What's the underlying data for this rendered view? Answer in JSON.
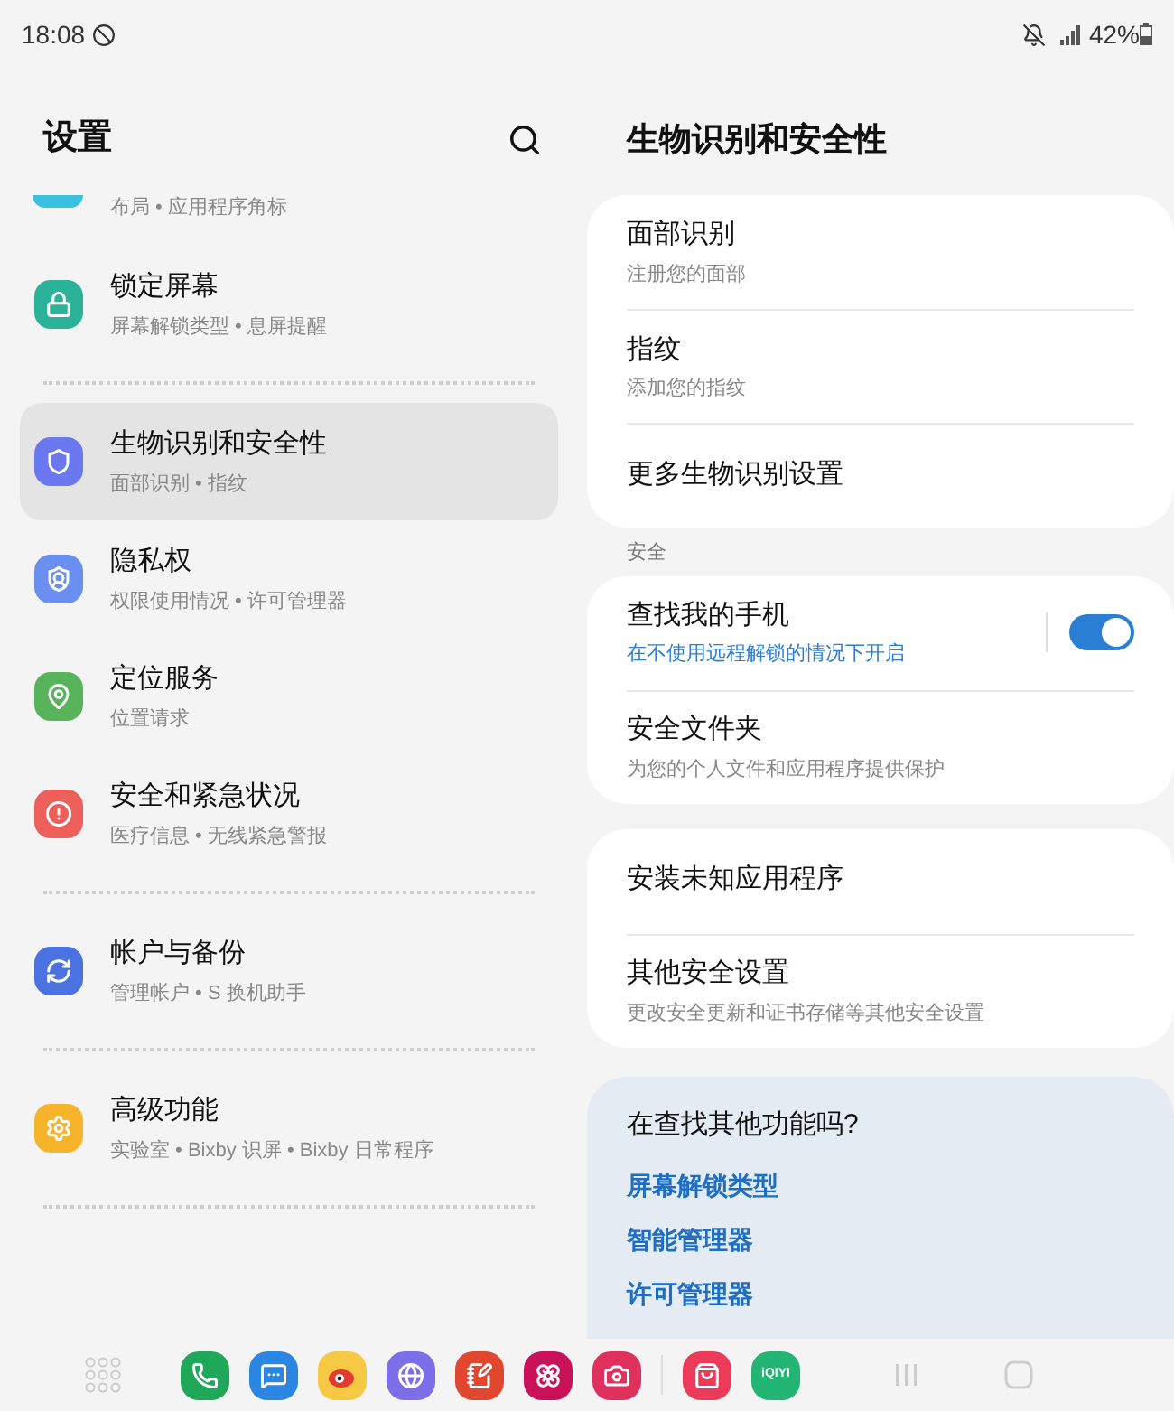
{
  "status_bar": {
    "time": "18:08",
    "battery": "42%"
  },
  "left": {
    "title": "设置",
    "partial_subtitle": "布局 • 应用程序角标",
    "groups": [
      {
        "items": [
          {
            "title": "锁定屏幕",
            "subtitle": "屏幕解锁类型 • 息屏提醒",
            "color": "#2bb39a",
            "selected": false
          }
        ]
      },
      {
        "items": [
          {
            "title": "生物识别和安全性",
            "subtitle": "面部识别 • 指纹",
            "color": "#6c78f0",
            "selected": true
          },
          {
            "title": "隐私权",
            "subtitle": "权限使用情况 • 许可管理器",
            "color": "#6b8ff0",
            "selected": false
          },
          {
            "title": "定位服务",
            "subtitle": "位置请求",
            "color": "#57b45a",
            "selected": false
          },
          {
            "title": "安全和紧急状况",
            "subtitle": "医疗信息 • 无线紧急警报",
            "color": "#ec5f5a",
            "selected": false
          }
        ]
      },
      {
        "items": [
          {
            "title": "帐户与备份",
            "subtitle": "管理帐户 • S 换机助手",
            "color": "#4a72e0",
            "selected": false
          }
        ]
      },
      {
        "items": [
          {
            "title": "高级功能",
            "subtitle": "实验室 • Bixby 识屏 • Bixby 日常程序",
            "color": "#f5b42a",
            "selected": false
          }
        ]
      }
    ]
  },
  "right": {
    "title": "生物识别和安全性",
    "cards": [
      {
        "rows": [
          {
            "kind": "row",
            "title": "面部识别",
            "subtitle": "注册您的面部"
          },
          {
            "kind": "row",
            "title": "指纹",
            "subtitle": "添加您的指纹"
          },
          {
            "kind": "row",
            "title": "更多生物识别设置"
          }
        ]
      },
      {
        "label": "安全",
        "rows": [
          {
            "kind": "toggle",
            "title": "查找我的手机",
            "subtitle": "在不使用远程解锁的情况下开启",
            "on": true
          },
          {
            "kind": "row",
            "title": "安全文件夹",
            "subtitle": "为您的个人文件和应用程序提供保护"
          }
        ]
      },
      {
        "rows": [
          {
            "kind": "row",
            "title": "安装未知应用程序"
          },
          {
            "kind": "row",
            "title": "其他安全设置",
            "subtitle": "更改安全更新和证书存储等其他安全设置"
          }
        ]
      }
    ],
    "suggestions": {
      "title": "在查找其他功能吗?",
      "links": [
        "屏幕解锁类型",
        "智能管理器",
        "许可管理器"
      ]
    }
  },
  "dock": {
    "apps": [
      {
        "color": "#1fa85a"
      },
      {
        "color": "#2a86e0"
      },
      {
        "color": "#f7c844"
      },
      {
        "color": "#7b6ee8"
      },
      {
        "color": "#e0472e"
      },
      {
        "color": "#c9125a"
      },
      {
        "color": "#e0305e"
      },
      {
        "color": "#ec3a5a"
      },
      {
        "color": "#22b573",
        "label": "iQIYI"
      }
    ]
  }
}
